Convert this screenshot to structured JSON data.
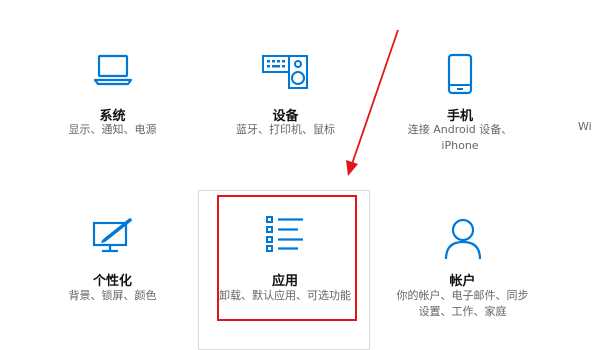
{
  "colors": {
    "accent": "#0078d7",
    "highlight": "#e0151a"
  },
  "tiles": {
    "system": {
      "icon": "laptop-icon",
      "title": "系统",
      "desc": [
        "显示、通知、电源"
      ]
    },
    "devices": {
      "icon": "keyboard-speaker-icon",
      "title": "设备",
      "desc": [
        "蓝牙、打印机、鼠标"
      ]
    },
    "phone": {
      "icon": "phone-icon",
      "title": "手机",
      "desc": [
        "连接 Android 设备、",
        "iPhone"
      ]
    },
    "personal": {
      "icon": "paint-brush-icon",
      "title": "个性化",
      "desc": [
        "背景、锁屏、颜色"
      ]
    },
    "apps": {
      "icon": "apps-list-icon",
      "title": "应用",
      "desc": [
        "卸载、默认应用、可选功能"
      ]
    },
    "accounts": {
      "icon": "person-icon",
      "title": "帐户",
      "desc": [
        "你的帐户、电子邮件、同步",
        "设置、工作、家庭"
      ]
    }
  },
  "cut_off_tile": {
    "label": "Wi"
  }
}
